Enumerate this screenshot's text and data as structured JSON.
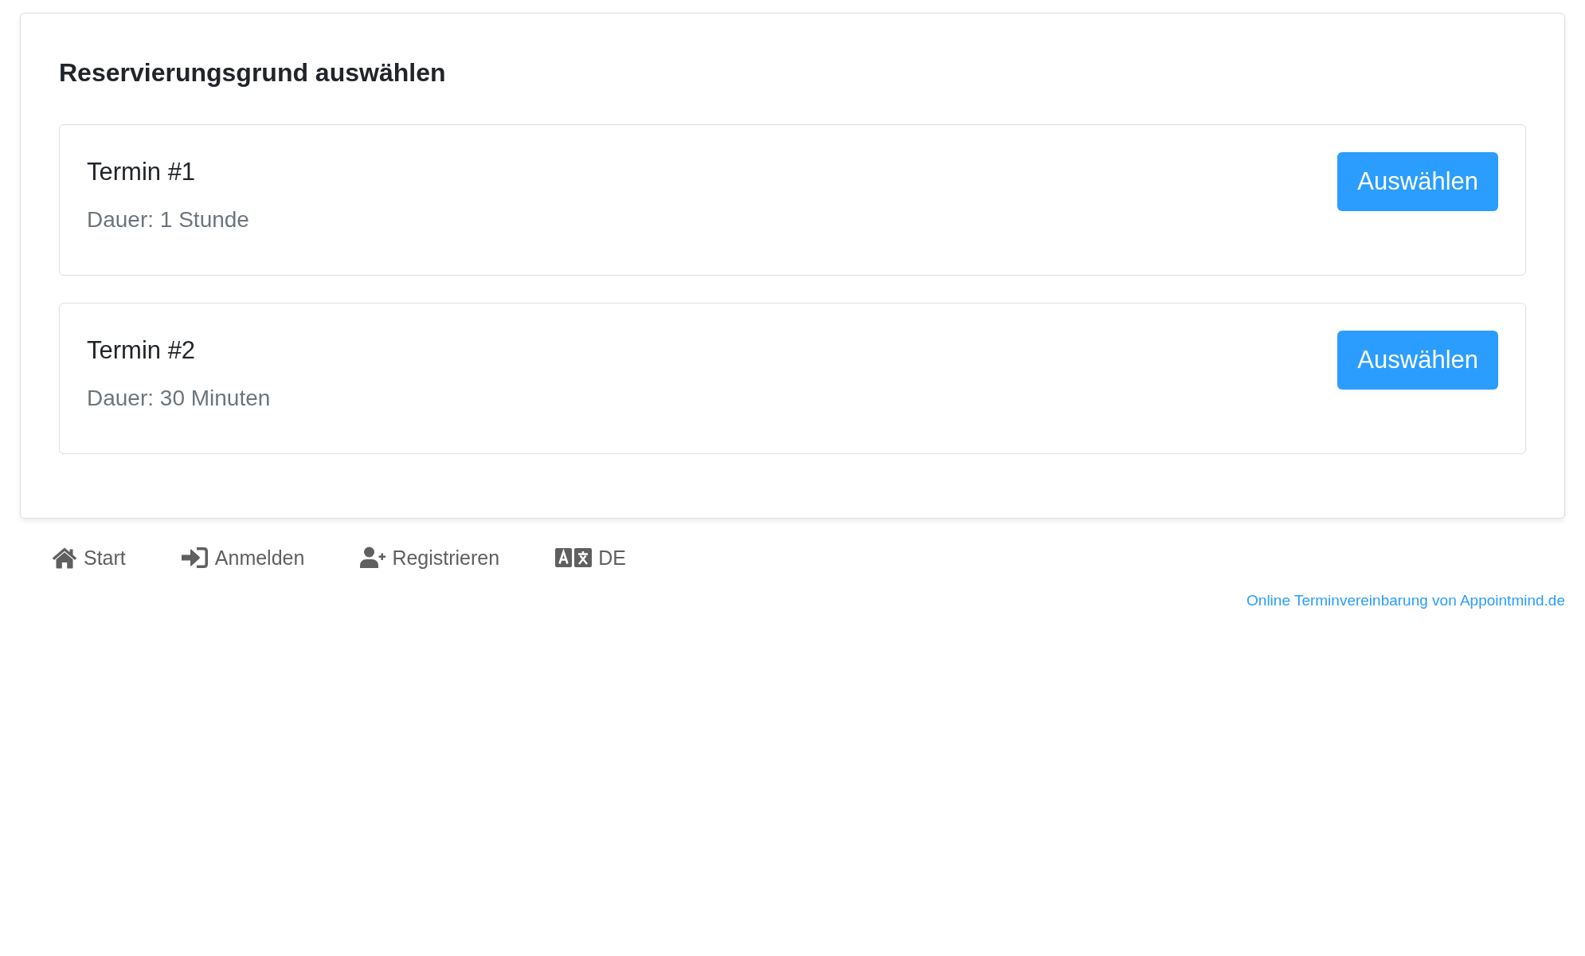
{
  "panel": {
    "heading": "Reservierungsgrund auswählen",
    "options": [
      {
        "title": "Termin #1",
        "duration": "Dauer: 1 Stunde",
        "button": "Auswählen"
      },
      {
        "title": "Termin #2",
        "duration": "Dauer: 30 Minuten",
        "button": "Auswählen"
      }
    ]
  },
  "footer_nav": [
    {
      "kind": "home",
      "label": "Start"
    },
    {
      "kind": "login",
      "label": "Anmelden"
    },
    {
      "kind": "register",
      "label": "Registrieren"
    },
    {
      "kind": "language",
      "label": "DE"
    }
  ],
  "credit": "Online Terminvereinbarung von Appointmind.de"
}
